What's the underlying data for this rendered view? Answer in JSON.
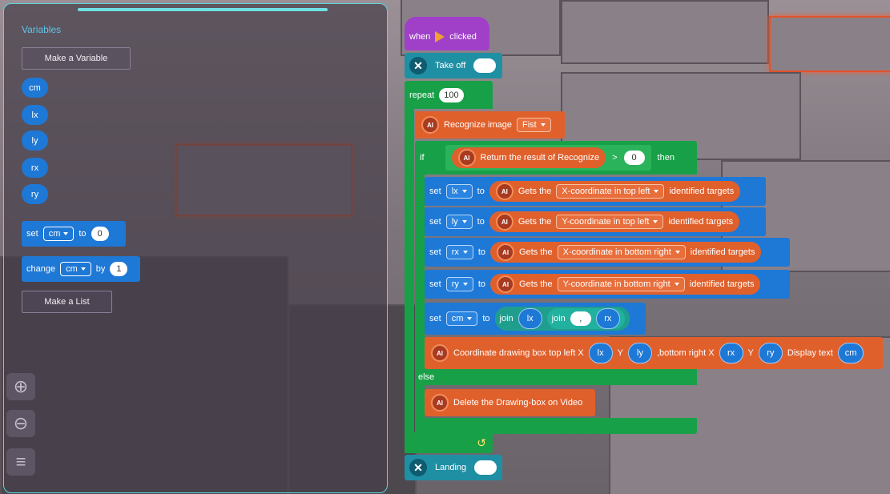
{
  "variables_panel": {
    "title": "Variables",
    "make_variable": "Make a Variable",
    "variables": [
      "cm",
      "lx",
      "ly",
      "rx",
      "ry"
    ],
    "set_block": {
      "label": "set",
      "var": "cm",
      "to": "to",
      "value": "0"
    },
    "change_block": {
      "label": "change",
      "var": "cm",
      "by": "by",
      "value": "1"
    },
    "make_list": "Make a List"
  },
  "script": {
    "hat": {
      "when": "when",
      "clicked": "clicked"
    },
    "takeoff": "Take off",
    "repeat": {
      "label": "repeat",
      "count": "100"
    },
    "recognize": {
      "label": "Recognize image",
      "option": "Fist"
    },
    "if": {
      "label": "if",
      "then": "then",
      "result": "Return the result of Recognize",
      "op": ">",
      "value": "0"
    },
    "set_rows": [
      {
        "set": "set",
        "var": "lx",
        "to": "to",
        "gets": "Gets the",
        "coord": "X-coordinate in top left",
        "suffix": "identified targets"
      },
      {
        "set": "set",
        "var": "ly",
        "to": "to",
        "gets": "Gets the",
        "coord": "Y-coordinate in top left",
        "suffix": "identified targets"
      },
      {
        "set": "set",
        "var": "rx",
        "to": "to",
        "gets": "Gets the",
        "coord": "X-coordinate in bottom right",
        "suffix": "identified targets"
      },
      {
        "set": "set",
        "var": "ry",
        "to": "to",
        "gets": "Gets the",
        "coord": "Y-coordinate in bottom right",
        "suffix": "identified targets"
      }
    ],
    "set_join": {
      "set": "set",
      "var": "cm",
      "to": "to",
      "join1": "join",
      "a": "lx",
      "join2": "join",
      "sep": ",",
      "b": "rx"
    },
    "draw": {
      "label": "Coordinate drawing box top left X",
      "x1": "lx",
      "y_lbl": "Y",
      "y1": "ly",
      "br": ",bottom right X",
      "x2": "rx",
      "y_lbl2": "Y",
      "y2": "ry",
      "disp": "Display text",
      "text": "cm"
    },
    "else": "else",
    "delete": "Delete the Drawing-box on  Video",
    "landing": "Landing"
  }
}
